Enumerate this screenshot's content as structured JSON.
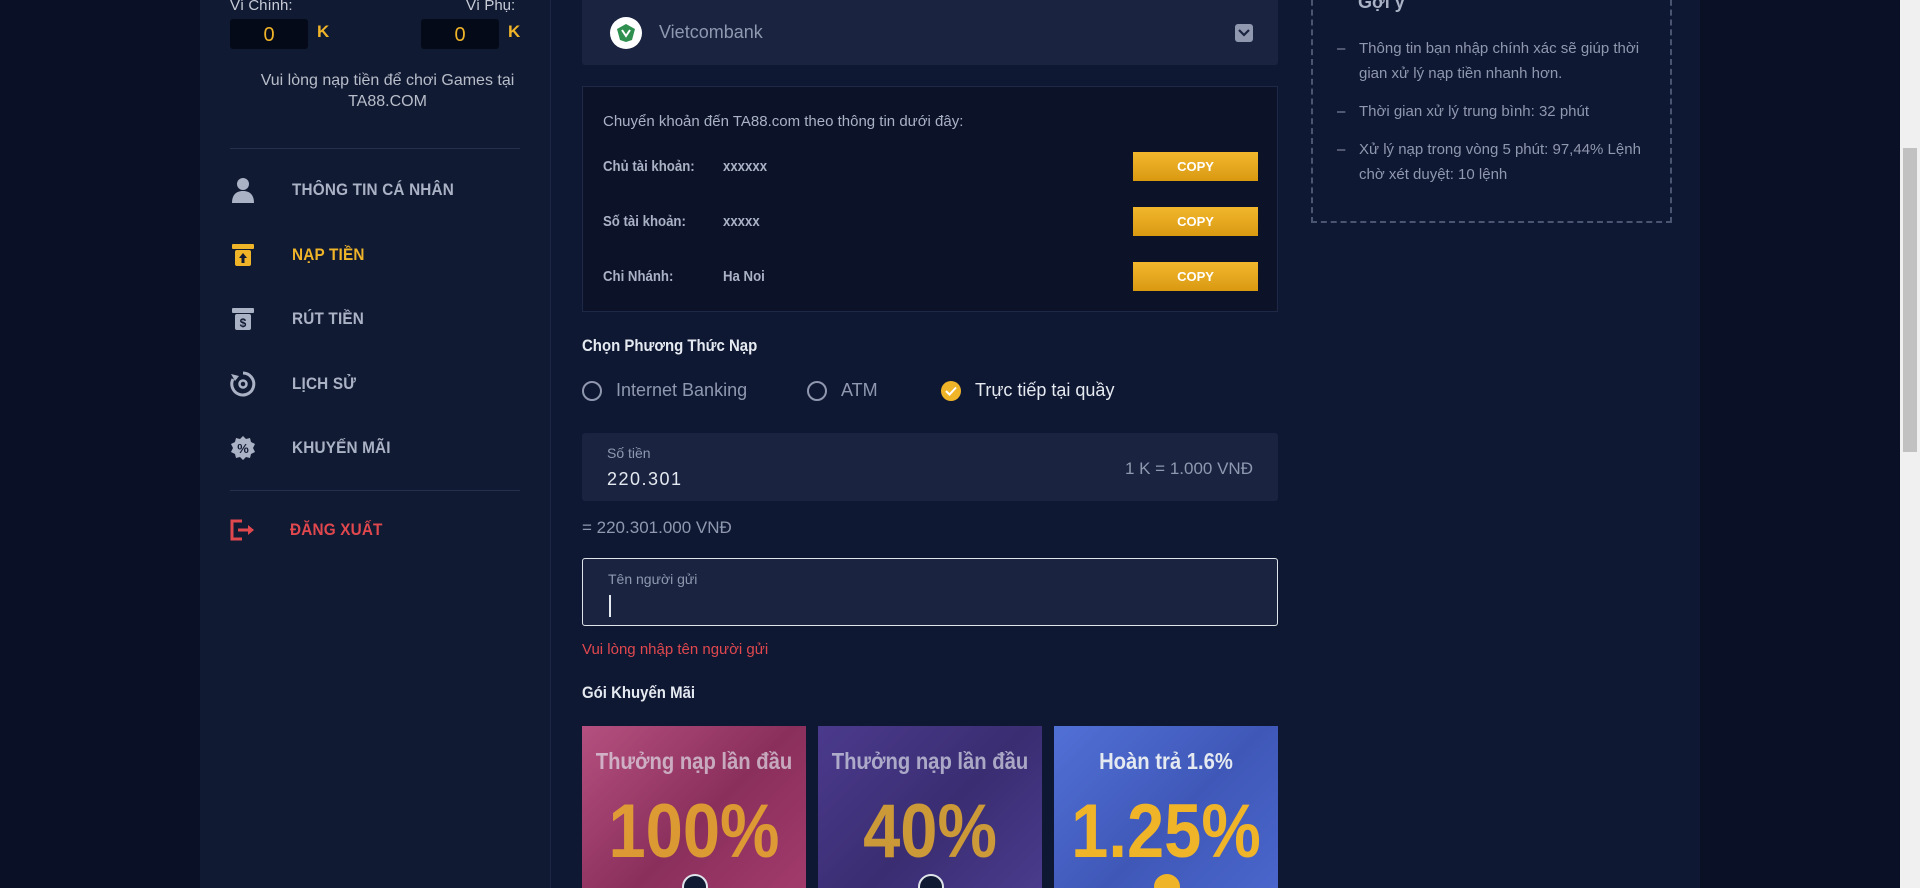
{
  "wallet": {
    "main_label": "Ví Chính:",
    "main_value": "0",
    "sub_label": "Ví Phụ:",
    "sub_value": "0",
    "unit": "K",
    "notice": "Vui lòng nạp tiền để chơi Games tại TA88.COM"
  },
  "menu": {
    "items": [
      {
        "label": "THÔNG TIN CÁ NHÂN",
        "icon": "user-icon"
      },
      {
        "label": "NẠP TIỀN",
        "icon": "deposit-icon"
      },
      {
        "label": "RÚT TIỀN",
        "icon": "withdraw-icon"
      },
      {
        "label": "LỊCH SỬ",
        "icon": "history-icon"
      },
      {
        "label": "KHUYẾN MÃI",
        "icon": "promotion-icon"
      }
    ],
    "logout": "ĐĂNG XUẤT",
    "active_color": "#f0b429",
    "logout_color": "#e0484e"
  },
  "bank": {
    "name": "Vietcombank"
  },
  "transfer": {
    "title": "Chuyển khoản đến TA88.com theo thông tin dưới đây:",
    "rows": [
      {
        "key": "Chủ tài khoản:",
        "value": "xxxxxx"
      },
      {
        "key": "Số tài khoản:",
        "value": "xxxxx"
      },
      {
        "key": "Chi Nhánh:",
        "value": "Ha Noi"
      }
    ],
    "copy_label": "COPY"
  },
  "method": {
    "title": "Chọn Phương Thức Nạp",
    "options": [
      "Internet Banking",
      "ATM",
      "Trực tiếp tại quầy"
    ],
    "selected": "Trực tiếp tại quầy"
  },
  "amount": {
    "label": "Số tiền",
    "value": "220.301",
    "rate": "1 K = 1.000 VNĐ",
    "converted": "= 220.301.000 VNĐ"
  },
  "sender": {
    "label": "Tên người gửi",
    "value": "",
    "error": "Vui lòng nhập tên người gửi"
  },
  "promotions": {
    "title": "Gói Khuyến Mãi",
    "items": [
      {
        "title": "Thưởng nạp lần đầu",
        "value": "100%",
        "color": "#c2457a"
      },
      {
        "title": "Thưởng nạp lần đầu",
        "value": "40%",
        "color": "#5a3f9a"
      },
      {
        "title": "Hoàn trả 1.6%",
        "value": "1.25%",
        "color": "#4660c8"
      }
    ]
  },
  "tips": {
    "title": "Gợi ý",
    "items": [
      "Thông tin bạn nhập chính xác sẽ giúp thời gian xử lý nạp tiền nhanh hơn.",
      "Thời gian xử lý trung bình: 32 phút",
      "Xử lý nạp trong vòng 5 phút: 97,44% Lệnh chờ xét duyệt: 10 lệnh"
    ]
  }
}
